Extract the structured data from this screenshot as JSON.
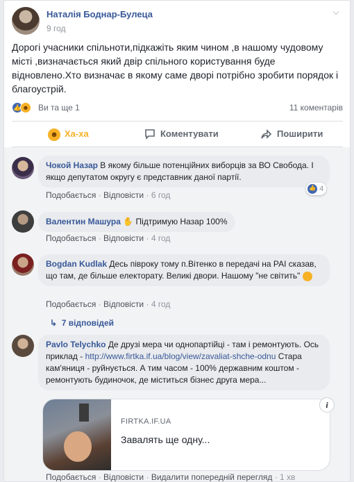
{
  "post": {
    "author": "Наталія Боднар-Булеца",
    "time": "9 год",
    "text": "Дорогі учасники спільноти,підкажіть яким чином ,в нашому чудовому місті ,визначається який двір спільного користування буде відновлено.Хто визначає в якому саме дворі потрібно зробити порядок і благоустрій.",
    "reactions_text": "Ви та ще 1",
    "comments_count": "11 коментарів"
  },
  "actions": {
    "haha": "Ха-ха",
    "comment": "Коментувати",
    "share": "Поширити"
  },
  "labels": {
    "like": "Подобається",
    "reply": "Відповісти",
    "separator": "·",
    "hide_prev": "Видалити попередній перегляд"
  },
  "comments": [
    {
      "name": "Чокой Назар",
      "text": "В якому більше потенційних виборців за ВО Свобода. І якщо депутатом округу є представник даної партії.",
      "time": "6 год",
      "reaction_count": "4"
    },
    {
      "name": "Валентин Машура",
      "text": "Підтримую Назар 100%",
      "time": "4 год"
    },
    {
      "name": "Bogdan Kudlak",
      "text": "Десь півроку тому п.Вітенко в передачі на РАІ сказав, що там, де більше електорату. Великі двори. Нашому \"не світить\"",
      "time": "4 год",
      "replies": "7 відповідей"
    },
    {
      "name": "Pavlo Telychko",
      "text_before": "Де друзі мера чи однопартійці - там і ремонтують. Ось приклад - ",
      "link": "http://www.firtka.if.ua/blog/view/zavaliat-shche-odnu",
      "text_after": " Стара кам'яниця - руйнується. А тим часом - 100% державним коштом - ремонтують будиночок, де міститься бізнес друга мера...",
      "time": "1 хв",
      "preview_domain": "FIRTKA.IF.UA",
      "preview_title": "Завалять ще одну..."
    }
  ],
  "icons": {
    "chevron": "chevron-down-icon",
    "like": "like-icon",
    "haha": "haha-icon",
    "comment": "comment-icon",
    "share": "share-icon",
    "reply_arrow": "reply-arrow-icon",
    "info": "info-icon",
    "wave": "wave-emoji-icon"
  },
  "colors": {
    "link": "#385898",
    "haha": "#f7b125",
    "like": "#4267b2"
  }
}
